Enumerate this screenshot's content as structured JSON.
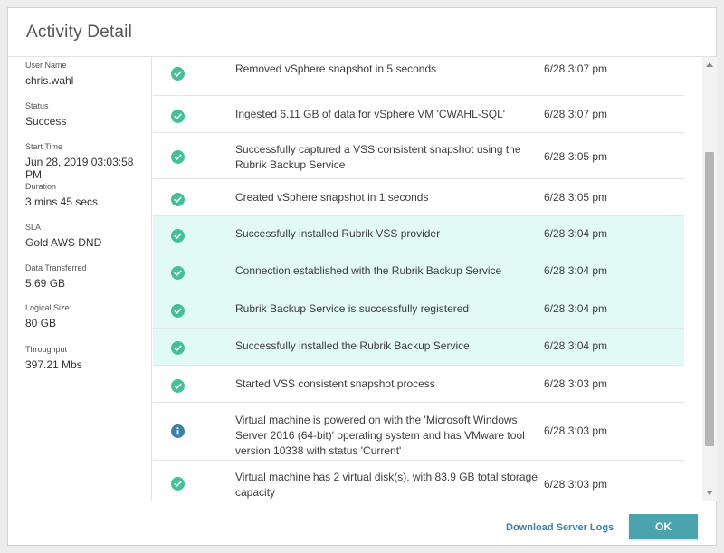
{
  "dialog": {
    "title": "Activity Detail"
  },
  "details": [
    {
      "label": "User Name",
      "value": "chris.wahl"
    },
    {
      "label": "Status",
      "value": "Success"
    },
    {
      "label": "Start Time",
      "value": "Jun 28, 2019 03:03:58 PM"
    },
    {
      "label": "Duration",
      "value": "3 mins 45 secs"
    },
    {
      "label": "SLA",
      "value": "Gold AWS DND"
    },
    {
      "label": "Data Transferred",
      "value": "5.69 GB"
    },
    {
      "label": "Logical Size",
      "value": "80 GB"
    },
    {
      "label": "Throughput",
      "value": "397.21 Mbs"
    }
  ],
  "events": [
    {
      "icon": "check-circle-icon",
      "status": "success",
      "text": "Removed vSphere snapshot in 5 seconds",
      "time": "6/28 3:07 pm",
      "highlight": false
    },
    {
      "icon": "check-circle-icon",
      "status": "success",
      "text": "Ingested 6.11 GB of data for vSphere VM 'CWAHL-SQL'",
      "time": "6/28 3:07 pm",
      "highlight": false
    },
    {
      "icon": "check-circle-icon",
      "status": "success",
      "text": "Successfully captured a VSS consistent snapshot using the Rubrik Backup Service",
      "time": "6/28 3:05 pm",
      "highlight": false
    },
    {
      "icon": "check-circle-icon",
      "status": "success",
      "text": "Created vSphere snapshot in 1 seconds",
      "time": "6/28 3:05 pm",
      "highlight": false
    },
    {
      "icon": "check-circle-icon",
      "status": "success",
      "text": "Successfully installed Rubrik VSS provider",
      "time": "6/28 3:04 pm",
      "highlight": true
    },
    {
      "icon": "check-circle-icon",
      "status": "success",
      "text": "Connection established with the Rubrik Backup Service",
      "time": "6/28 3:04 pm",
      "highlight": true
    },
    {
      "icon": "check-circle-icon",
      "status": "success",
      "text": "Rubrik Backup Service is successfully registered",
      "time": "6/28 3:04 pm",
      "highlight": true
    },
    {
      "icon": "check-circle-icon",
      "status": "success",
      "text": "Successfully installed the Rubrik Backup Service",
      "time": "6/28 3:04 pm",
      "highlight": true
    },
    {
      "icon": "check-circle-icon",
      "status": "success",
      "text": "Started VSS consistent snapshot process",
      "time": "6/28 3:03 pm",
      "highlight": false
    },
    {
      "icon": "info-circle-icon",
      "status": "info",
      "text": "Virtual machine is powered on with the 'Microsoft Windows Server 2016 (64-bit)' operating system and has VMware tool version 10338 with status 'Current'",
      "time": "6/28 3:03 pm",
      "highlight": false
    },
    {
      "icon": "check-circle-icon",
      "status": "success",
      "text": "Virtual machine has 2 virtual disk(s), with 83.9 GB total storage capacity",
      "time": "6/28 3:03 pm",
      "highlight": false
    }
  ],
  "footer": {
    "download_label": "Download Server Logs",
    "ok_label": "OK"
  },
  "colors": {
    "success": "#45bf98",
    "info": "#3a7fa6",
    "highlight_row": "#e2faf5",
    "ok_button": "#4aa3ad",
    "link": "#3a82a8"
  }
}
